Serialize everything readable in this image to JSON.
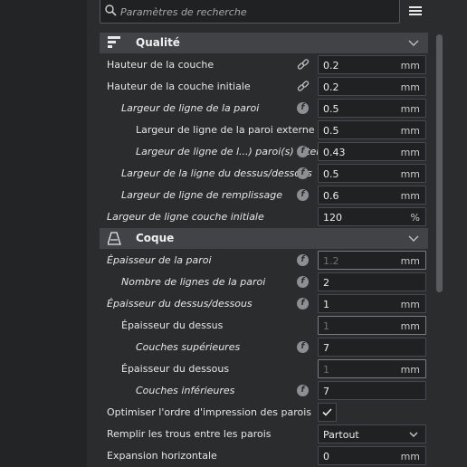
{
  "search": {
    "placeholder": "Paramètres de recherche"
  },
  "sections": {
    "quality": {
      "title": "Qualité"
    },
    "shell": {
      "title": "Coque"
    }
  },
  "quality_rows": [
    {
      "label": "Hauteur de la couche",
      "value": "0.2",
      "unit": "mm"
    },
    {
      "label": "Hauteur de la couche initiale",
      "value": "0.2",
      "unit": "mm"
    },
    {
      "label": "Largeur de ligne de la paroi",
      "value": "0.5",
      "unit": "mm"
    },
    {
      "label": "Largeur de ligne de la paroi externe",
      "value": "0.5",
      "unit": "mm"
    },
    {
      "label": "Largeur de ligne de l...) paroi(s) interne(s)",
      "value": "0.43",
      "unit": "mm"
    },
    {
      "label": "Largeur de la ligne du dessus/dessous",
      "value": "0.5",
      "unit": "mm"
    },
    {
      "label": "Largeur de ligne de remplissage",
      "value": "0.6",
      "unit": "mm"
    },
    {
      "label": "Largeur de ligne couche initiale",
      "value": "120",
      "unit": "%"
    }
  ],
  "shell_rows": [
    {
      "label": "Épaisseur de la paroi",
      "value": "1.2",
      "unit": "mm"
    },
    {
      "label": "Nombre de lignes de la paroi",
      "value": "2",
      "unit": ""
    },
    {
      "label": "Épaisseur du dessus/dessous",
      "value": "1",
      "unit": "mm"
    },
    {
      "label": "Épaisseur du dessus",
      "value": "1",
      "unit": "mm"
    },
    {
      "label": "Couches supérieures",
      "value": "7",
      "unit": ""
    },
    {
      "label": "Épaisseur du dessous",
      "value": "1",
      "unit": "mm"
    },
    {
      "label": "Couches inférieures",
      "value": "7",
      "unit": ""
    },
    {
      "label": "Optimiser l'ordre d'impression des parois",
      "checked": true
    },
    {
      "label": "Remplir les trous entre les parois",
      "value": "Partout"
    },
    {
      "label": "Expansion horizontale",
      "value": "0",
      "unit": "mm"
    }
  ],
  "icons": {
    "search": "search-icon",
    "menu": "hamburger-menu-icon",
    "quality": "quality-icon",
    "shell": "shell-icon",
    "link": "link-icon",
    "function": "function-icon",
    "chevron": "chevron-down-icon",
    "check": "check-icon"
  },
  "colors": {
    "panel": "#2b2c2e",
    "section": "#414346",
    "field": "#202122",
    "text": "#e6e6e6"
  }
}
